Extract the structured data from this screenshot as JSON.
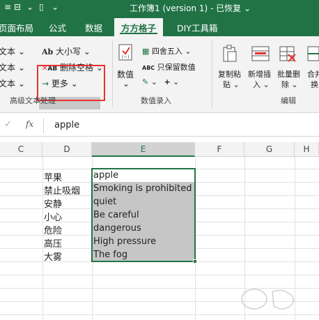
{
  "window": {
    "title": "工作簿1 (version 1)  -  已恢复  ⌄"
  },
  "ribbon_tabs": [
    "页面布局",
    "公式",
    "数据",
    "方方格子",
    "DIY工具箱"
  ],
  "ribbon": {
    "left_column": [
      "文本 ⌄",
      "文本 ⌄",
      "文本 ⌄"
    ],
    "case_button": "大小写",
    "remove_space_button": "删除空格",
    "more_button": "更多",
    "group_advanced_text": "高级文本处理",
    "numeric_button": "数值",
    "round_button": "四舍五入",
    "keep_numeric_button": "只保留数值",
    "group_numeric_input": "数值录入",
    "copy_paste_button": [
      "复制粘",
      "贴 ⌄"
    ],
    "add_insert_button": [
      "新增插",
      "入 ⌄"
    ],
    "batch_delete_button": [
      "批量删",
      "除 ⌄"
    ],
    "merge_button": [
      "合并",
      "换"
    ],
    "group_edit": "编辑",
    "accent_color": "#217346",
    "highlight_color": "#e8312f"
  },
  "formula_bar": {
    "fx_label": "fx",
    "value": "apple"
  },
  "columns": [
    "C",
    "D",
    "E",
    "F",
    "G",
    "H"
  ],
  "selected_column": "E",
  "rows": [
    {
      "d": "苹果",
      "e": "apple"
    },
    {
      "d": "禁止吸烟",
      "e": "Smoking is prohibited"
    },
    {
      "d": "安静",
      "e": "quiet"
    },
    {
      "d": "小心",
      "e": "Be careful"
    },
    {
      "d": "危险",
      "e": "dangerous"
    },
    {
      "d": "高压",
      "e": "High pressure"
    },
    {
      "d": "大雾",
      "e": "The fog"
    }
  ]
}
